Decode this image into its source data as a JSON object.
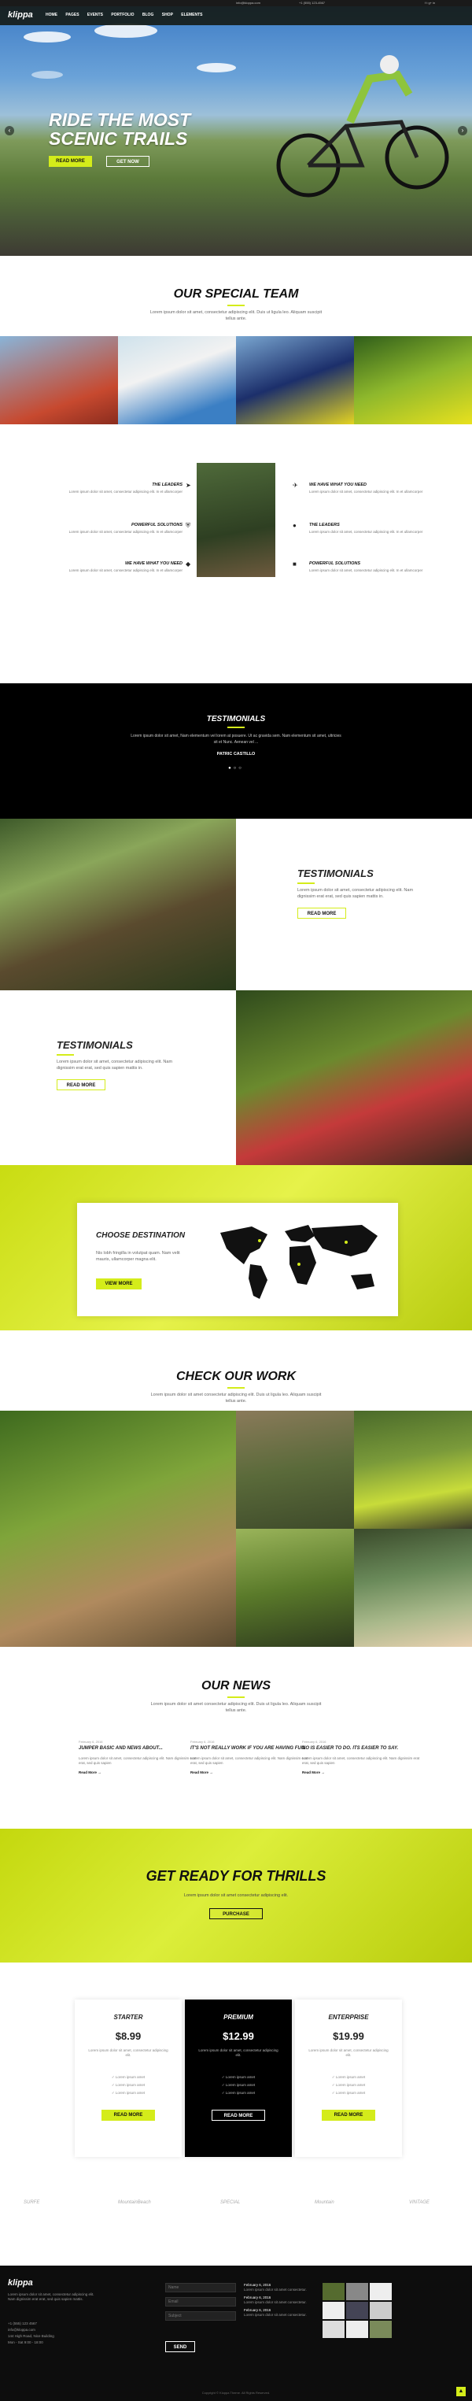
{
  "topbar": {
    "email": "info@kloppa.com",
    "phone": "+1 (555) 123-4567",
    "social": "f  t  g+  in"
  },
  "nav": {
    "logo": "klippa",
    "items": [
      "HOME",
      "PAGES",
      "EVENTS",
      "PORTFOLIO",
      "BLOG",
      "SHOP",
      "ELEMENTS"
    ]
  },
  "hero": {
    "title_l1": "RIDE THE MOST",
    "title_l2": "SCENIC TRAILS",
    "btn_primary": "READ MORE",
    "btn_secondary": "GET NOW"
  },
  "team": {
    "title": "OUR SPECIAL TEAM",
    "text": "Lorem ipsum dolor sit amet, consectetur adipiscing elit. Duis ut ligula leo. Aliquam suscipit tellus ante."
  },
  "features": {
    "left": [
      {
        "t": "THE LEADERS",
        "d": "Lorem ipsum dolor sit amet, consectetur adipiscing elit. In et ullamcorper"
      },
      {
        "t": "POWERFUL SOLUTIONS",
        "d": "Lorem ipsum dolor sit amet, consectetur adipiscing elit. In et ullamcorper"
      },
      {
        "t": "WE HAVE WHAT YOU NEED",
        "d": "Lorem ipsum dolor sit amet, consectetur adipiscing elit. In et ullamcorper"
      }
    ],
    "right": [
      {
        "t": "WE HAVE WHAT YOU NEED",
        "d": "Lorem ipsum dolor sit amet, consectetur adipiscing elit. In et ullamcorper"
      },
      {
        "t": "THE LEADERS",
        "d": "Lorem ipsum dolor sit amet, consectetur adipiscing elit. In et ullamcorper"
      },
      {
        "t": "POWERFUL SOLUTIONS",
        "d": "Lorem ipsum dolor sit amet, consectetur adipiscing elit. In et ullamcorper"
      }
    ]
  },
  "testimonial_dark": {
    "title": "TESTIMONIALS",
    "quote": "Lorem ipsum dolor sit amet, Nam elementum vel lorem at posuere. Ut ac gravida sem. Nam elementum sit amet, ultricies sit et Nunc. Aenean vel ...",
    "author": "PATRIC CASTILLO"
  },
  "testimonial_1": {
    "title": "TESTIMONIALS",
    "text": "Lorem ipsum dolor sit amet, consectetur adipiscing elit. Nam dignissim erat erat, sed quis sapien mattis in.",
    "btn": "READ MORE"
  },
  "testimonial_2": {
    "title": "TESTIMONIALS",
    "text": "Lorem ipsum dolor sit amet, consectetur adipiscing elit. Nam dignissim erat erat, sed quis sapien mattis in.",
    "btn": "READ MORE"
  },
  "destination": {
    "title": "CHOOSE DESTINATION",
    "text": "Nis lobh fringilla in volutpat quam. Nam velit mauris, ullamcorper magna elit.",
    "btn": "VIEW MORE"
  },
  "work": {
    "title": "CHECK OUR WORK",
    "text": "Lorem ipsum dolor sit amet consectetur adipiscing elit. Duis ut ligula leo. Aliquam suscipit tellus ante."
  },
  "news": {
    "title": "OUR NEWS",
    "text": "Lorem ipsum dolor sit amet consectetur adipiscing elit. Duis ut ligula leo. Aliquam suscipit tellus ante.",
    "items": [
      {
        "dt": "February 6, 2016",
        "t": "JUMPER BASIC AND NEWS ABOUT...",
        "d": "Lorem ipsum dolor sit amet, consectetur adipiscing elit. Nam dignissim erat erat, sed quis sapien",
        "r": "Read More →"
      },
      {
        "dt": "February 6, 2016",
        "t": "IT'S NOT REALLY WORK IF YOU ARE HAVING FUN.",
        "d": "Lorem ipsum dolor sit amet, consectetur adipiscing elit. Nam dignissim erat erat, sed quis sapien",
        "r": "Read More →"
      },
      {
        "dt": "February 6, 2016",
        "t": "NO IS EASIER TO DO. ITS EASIER TO SAY.",
        "d": "Lorem ipsum dolor sit amet, consectetur adipiscing elit. Nam dignissim erat erat, sed quis sapien",
        "r": "Read More →"
      }
    ]
  },
  "cta": {
    "title": "GET READY FOR THRILLS",
    "text": "Lorem ipsum dolor sit amet consectetur adipiscing elit.",
    "btn": "PURCHASE"
  },
  "pricing": [
    {
      "n": "STARTER",
      "p": "$8.99",
      "d": "Lorem ipsum dolor sit amet, consectetur adipiscing elit.",
      "f": [
        "Lorem ipsum amet",
        "Lorem ipsum amet",
        "Lorem ipsum amet"
      ],
      "b": "READ MORE"
    },
    {
      "n": "PREMIUM",
      "p": "$12.99",
      "d": "Lorem ipsum dolor sit amet, consectetur adipiscing elit.",
      "f": [
        "Lorem ipsum amet",
        "Lorem ipsum amet",
        "Lorem ipsum amet"
      ],
      "b": "READ MORE"
    },
    {
      "n": "ENTERPRISE",
      "p": "$19.99",
      "d": "Lorem ipsum dolor sit amet, consectetur adipiscing elit.",
      "f": [
        "Lorem ipsum amet",
        "Lorem ipsum amet",
        "Lorem ipsum amet"
      ],
      "b": "READ MORE"
    }
  ],
  "partners": [
    "SURFE",
    "MountainBeach",
    "SPECIAL",
    "Mountain",
    "VINTAGE"
  ],
  "footer": {
    "logo": "klippa",
    "about": "Lorem ipsum dolor sit amet, consectetur adipiscing elit. Nam dignissim erat erat, sed quis sapien mattis.",
    "contact": [
      "+1 (555) 123 4567",
      "info@kloppa.com",
      "144 High Road, Nice Building",
      "Mon - Sat 9:00 - 18:00"
    ],
    "form": [
      "Name",
      "Email",
      "Subject"
    ],
    "submit": "SEND",
    "posts": [
      {
        "dt": "February 6, 2016",
        "t": "Lorem ipsum dolor sit amet consectetur."
      },
      {
        "dt": "February 6, 2016",
        "t": "Lorem ipsum dolor sit amet consectetur."
      },
      {
        "dt": "February 6, 2016",
        "t": "Lorem ipsum dolor sit amet consectetur."
      }
    ],
    "copyright": "Copyright © Kloppa Theme. All Rights Reserved."
  }
}
